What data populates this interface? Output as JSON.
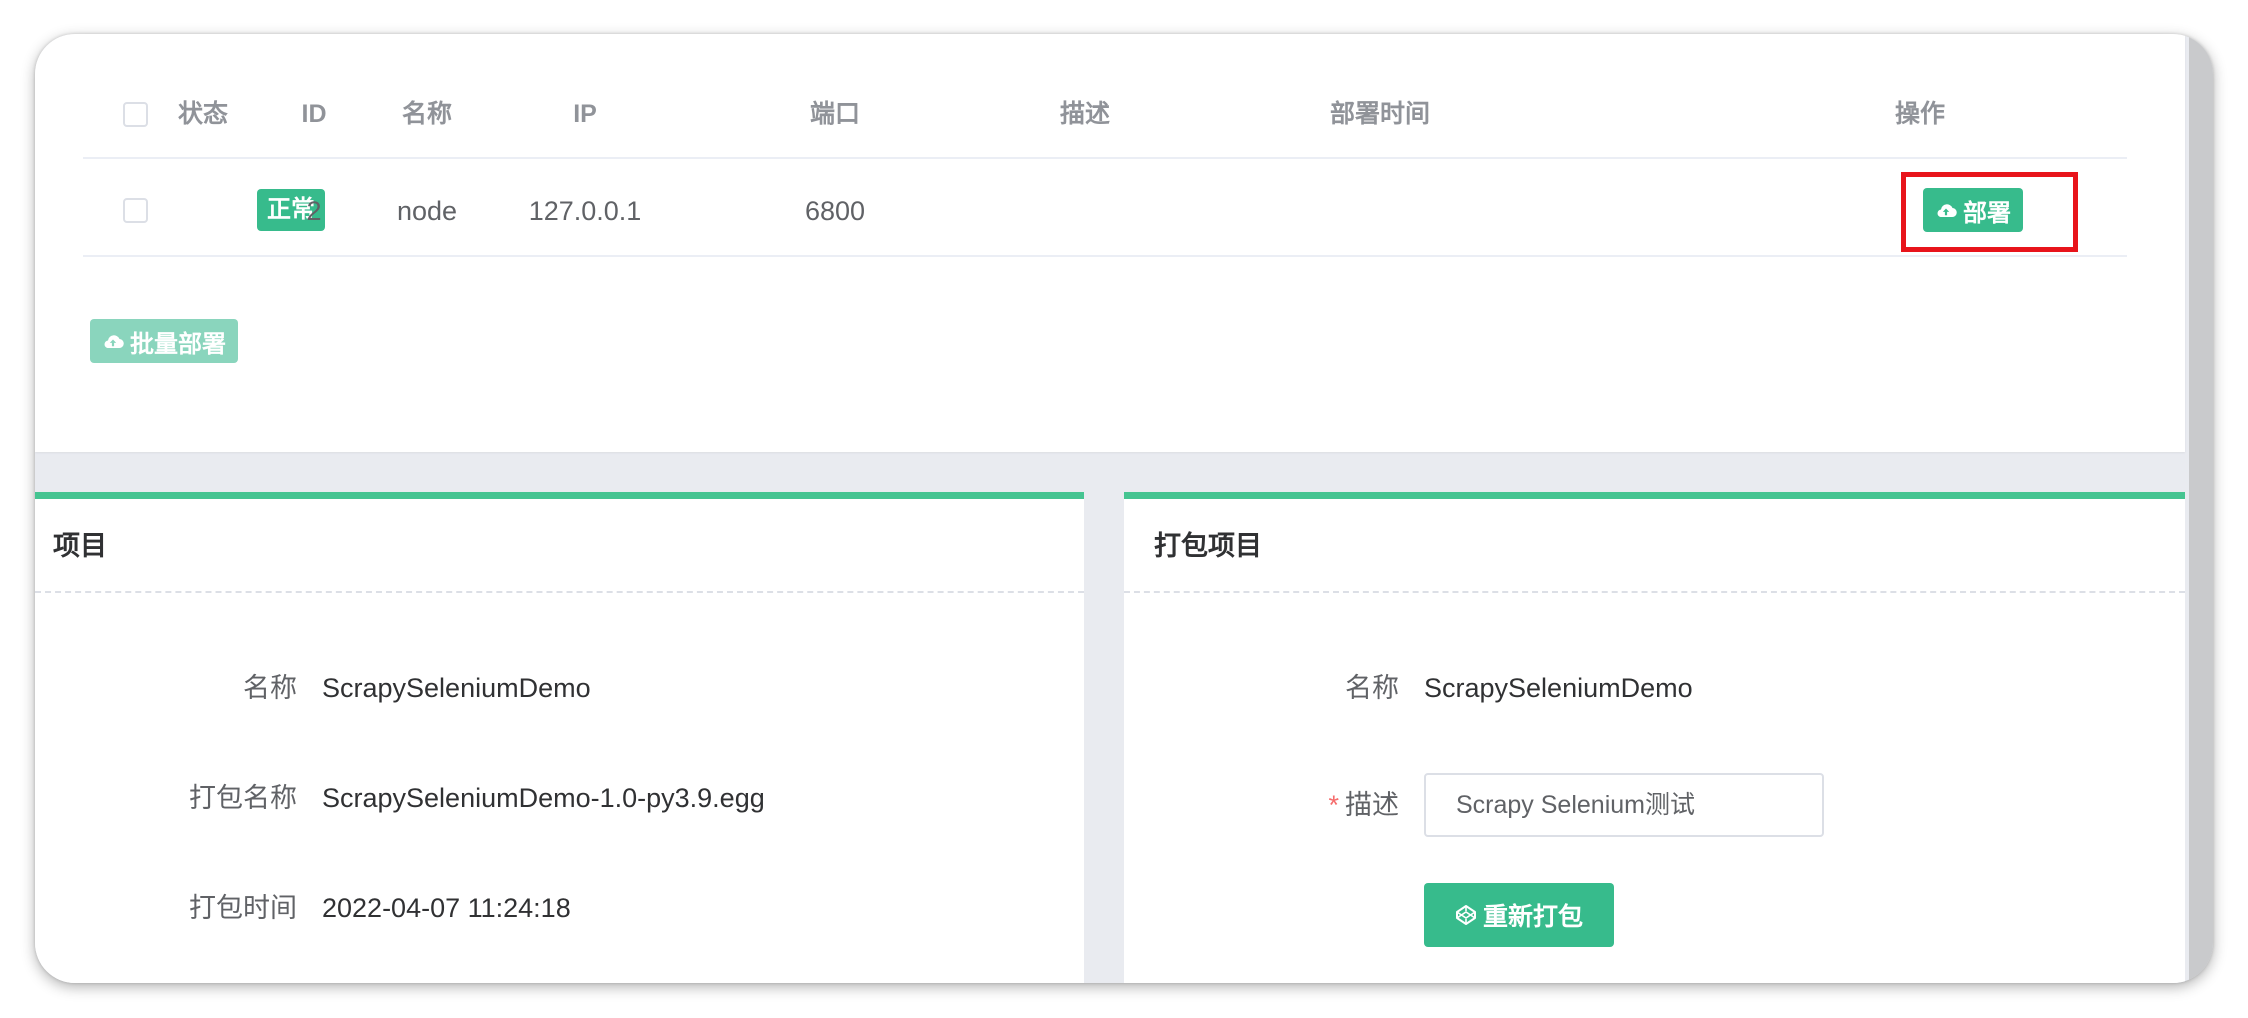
{
  "table": {
    "columns": [
      "状态",
      "ID",
      "名称",
      "IP",
      "端口",
      "描述",
      "部署时间",
      "操作"
    ],
    "rows": [
      {
        "status": "正常",
        "id": "2",
        "name": "node",
        "ip": "127.0.0.1",
        "port": "6800",
        "description": "",
        "deploy_time": "",
        "action_label": "部署",
        "action_icon": "cloud-upload-icon"
      }
    ],
    "batch_deploy_label": "批量部署",
    "batch_deploy_icon": "cloud-upload-icon"
  },
  "project_panel": {
    "title": "项目",
    "fields": [
      {
        "label": "名称",
        "value": "ScrapySeleniumDemo"
      },
      {
        "label": "打包名称",
        "value": "ScrapySeleniumDemo-1.0-py3.9.egg"
      },
      {
        "label": "打包时间",
        "value": "2022-04-07 11:24:18"
      }
    ]
  },
  "package_panel": {
    "title": "打包项目",
    "name_label": "名称",
    "name_value": "ScrapySeleniumDemo",
    "required_mark": "*",
    "description_label": "描述",
    "description_value": "Scrapy Selenium测试",
    "repack_label": "重新打包",
    "repack_icon": "codepen-icon"
  },
  "colors": {
    "primary": "#37bb8c",
    "primary_light": "#8ad5bd",
    "panel_accent": "#45c491",
    "highlight": "#e8141b",
    "required": "#f56c6c"
  }
}
